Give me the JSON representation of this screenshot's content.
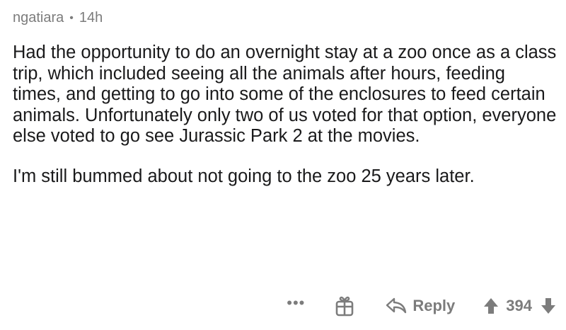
{
  "comment": {
    "author": "ngatiara",
    "separator": "•",
    "time": "14h",
    "paragraphs": [
      "Had the opportunity to do an overnight stay at a zoo once as a class trip, which included seeing all the animals after hours, feeding times, and getting to go into some of the enclosures to feed certain animals. Unfortunately only two of us voted for that option, everyone else voted to go see Jurassic Park 2 at the movies.",
      "I'm still bummed about not going to the zoo 25 years later."
    ]
  },
  "actions": {
    "more_label": "•••",
    "reply_label": "Reply",
    "vote_count": "394"
  },
  "icons": {
    "gift": "gift-icon",
    "reply": "reply-arrow-icon",
    "upvote": "upvote-arrow-icon",
    "downvote": "downvote-arrow-icon"
  },
  "colors": {
    "text": "#1a1a1b",
    "meta": "#7c7c7c"
  }
}
